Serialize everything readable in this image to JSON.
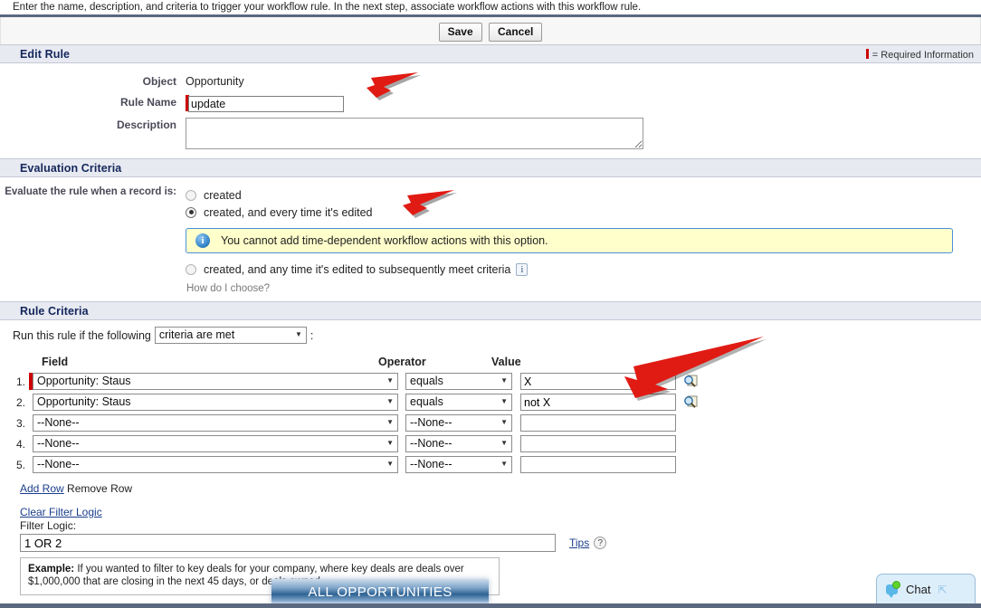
{
  "instruction": "Enter the name, description, and criteria to trigger your workflow rule. In the next step, associate workflow actions with this workflow rule.",
  "toolbar": {
    "save_label": "Save",
    "cancel_label": "Cancel"
  },
  "edit_rule": {
    "title": "Edit Rule",
    "required_note": "= Required Information",
    "object_label": "Object",
    "object_value": "Opportunity",
    "rule_name_label": "Rule Name",
    "rule_name_value": "update",
    "description_label": "Description",
    "description_value": ""
  },
  "evaluation_criteria": {
    "title": "Evaluation Criteria",
    "label": "Evaluate the rule when a record is:",
    "options": [
      {
        "label": "created",
        "checked": false
      },
      {
        "label": "created, and every time it's edited",
        "checked": true
      },
      {
        "label": "created, and any time it's edited to subsequently meet criteria",
        "checked": false
      }
    ],
    "info_message": "You cannot add time-dependent workflow actions with this option.",
    "info_icon": "info-circle-icon",
    "help_badge": "i",
    "how_do_i_choose": "How do I choose?"
  },
  "rule_criteria": {
    "title": "Rule Criteria",
    "run_rule_prefix": "Run this rule if the following",
    "run_rule_selected": "criteria are met",
    "run_rule_suffix": ":",
    "headers": {
      "field": "Field",
      "operator": "Operator",
      "value": "Value"
    },
    "rows": [
      {
        "num": "1.",
        "required": true,
        "field": "Opportunity: Staus",
        "operator": "equals",
        "value": "X",
        "lookup": true
      },
      {
        "num": "2.",
        "required": false,
        "field": "Opportunity: Staus",
        "operator": "equals",
        "value": "not X",
        "lookup": true
      },
      {
        "num": "3.",
        "required": false,
        "field": "--None--",
        "operator": "--None--",
        "value": "",
        "lookup": false
      },
      {
        "num": "4.",
        "required": false,
        "field": "--None--",
        "operator": "--None--",
        "value": "",
        "lookup": false
      },
      {
        "num": "5.",
        "required": false,
        "field": "--None--",
        "operator": "--None--",
        "value": "",
        "lookup": false
      }
    ],
    "add_row": "Add Row",
    "remove_row": "Remove Row",
    "clear_filter_logic": "Clear Filter Logic",
    "filter_logic_label": "Filter Logic:",
    "filter_logic_value": "1 OR 2",
    "tips_label": "Tips",
    "tips_badge": "?"
  },
  "example": {
    "bold_prefix": "Example:",
    "text": " If you wanted to filter to key deals for your company, where key deals are deals over $1,000,000 that are closing in the next 45 days, or deals owned"
  },
  "overlay": {
    "all_opportunities": "ALL OPPORTUNITIES"
  },
  "chat": {
    "label": "Chat",
    "status_icon": "chat-bubble-icon",
    "expand_icon": "expand-icon"
  },
  "colors": {
    "accent_blue": "#5a6880",
    "section_header_bg": "#e8eaf2",
    "section_title": "#14275b",
    "required_red": "#cc0000",
    "info_bg": "#ffffcc",
    "info_border": "#4a90d9",
    "link_blue": "#1a3e8c",
    "arrow_red": "#e01b14"
  }
}
